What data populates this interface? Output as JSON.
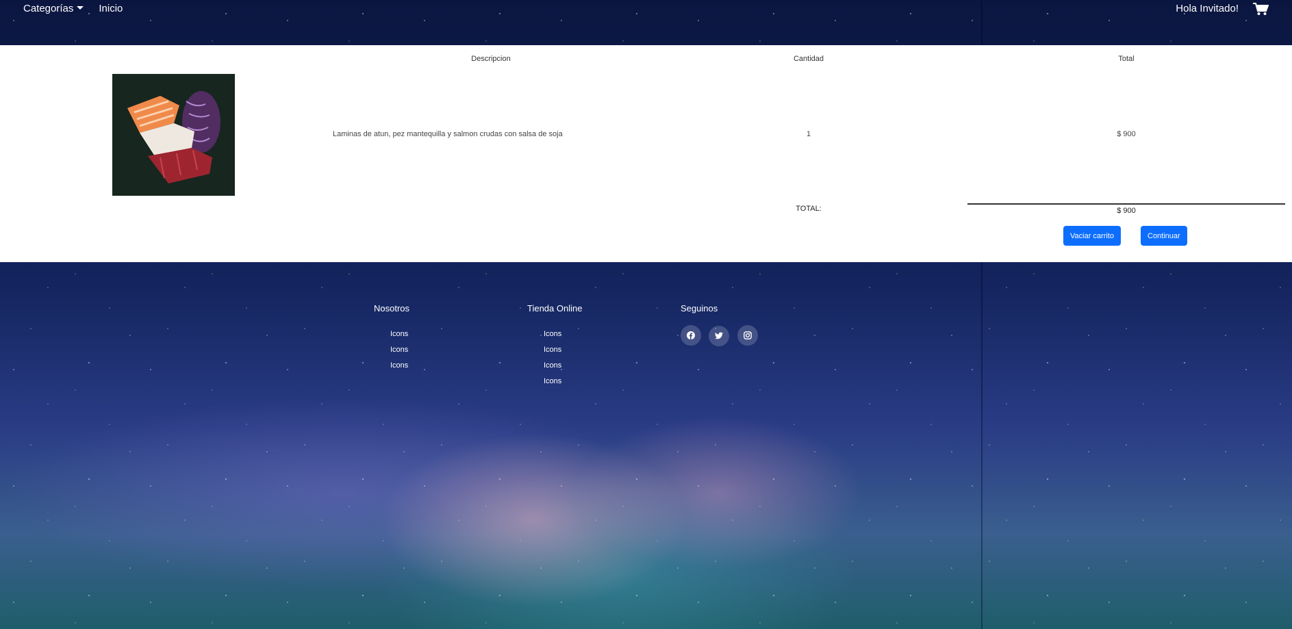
{
  "nav": {
    "categories_label": "Categorías",
    "home_label": "Inicio",
    "greeting": "Hola Invitado!"
  },
  "cart": {
    "headers": {
      "description": "Descripcion",
      "quantity": "Cantidad",
      "total": "Total"
    },
    "item": {
      "description": "Laminas de atun, pez mantequilla y salmon crudas con salsa de soja",
      "quantity": "1",
      "total": "$ 900"
    },
    "total_label": "TOTAL:",
    "grand_total": "$ 900",
    "empty_button": "Vaciar carrito",
    "continue_button": "Continuar"
  },
  "footer": {
    "about": {
      "title": "Nosotros",
      "items": [
        "Icons",
        "Icons",
        "Icons"
      ]
    },
    "store": {
      "title": "Tienda Online",
      "items": [
        "Icons",
        "Icons",
        "Icons",
        "Icons"
      ]
    },
    "social": {
      "title": "Seguinos",
      "icons": [
        "facebook-icon",
        "twitter-icon",
        "instagram-icon"
      ]
    }
  },
  "colors": {
    "accent": "#0d6efd",
    "navy": "#0b1640"
  }
}
